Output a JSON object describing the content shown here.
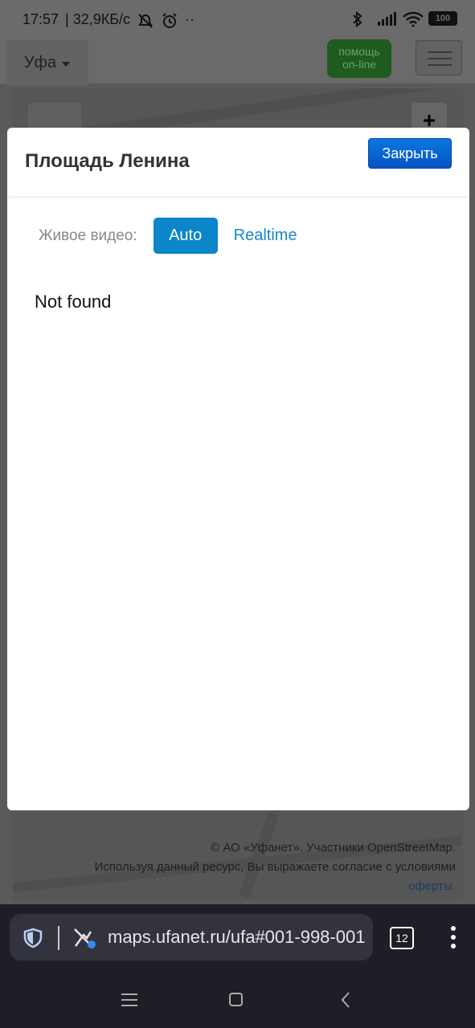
{
  "status_bar": {
    "time": "17:57",
    "speed": "| 32,9КБ/с",
    "dots": "··",
    "battery": "100"
  },
  "background_page": {
    "city": "Уфа",
    "help_line1": "помощь",
    "help_line2": "on-line",
    "zoom_plus": "+",
    "attribution_line1": "© АО «Уфанет». Участники OpenStreetMap.",
    "attribution_line2": "Используя данный ресурс, Вы выражаете согласие с условиями",
    "attribution_link": "оферты."
  },
  "modal": {
    "title": "Площадь Ленина",
    "close_label": "Закрыть",
    "live_video_label": "Живое видео:",
    "auto_label": "Auto",
    "realtime_label": "Realtime",
    "content_text": "Not found"
  },
  "browser": {
    "url": "maps.ufanet.ru/ufa#001-998-001",
    "tabs_count": "12"
  },
  "colors": {
    "primary_button": "#0a86c9",
    "close_button": "#0654c4",
    "link": "#1a86c8",
    "browser_bg": "#1e1e26"
  }
}
